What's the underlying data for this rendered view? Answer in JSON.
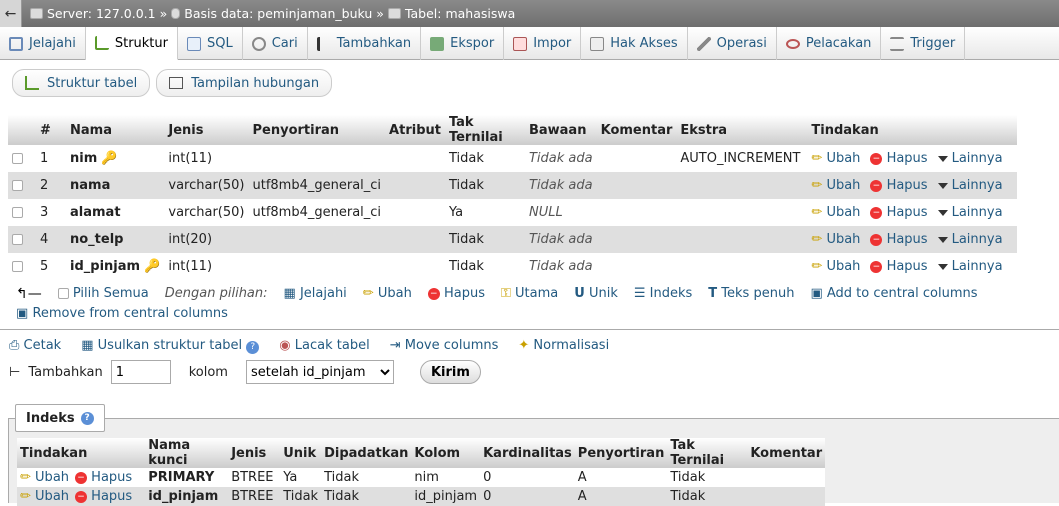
{
  "breadcrumb": {
    "server": "Server: 127.0.0.1",
    "database": "Basis data: peminjaman_buku",
    "table": "Tabel: mahasiswa"
  },
  "tabs": [
    {
      "label": "Jelajahi",
      "icon": "browse-icon"
    },
    {
      "label": "Struktur",
      "icon": "structure-icon",
      "active": true
    },
    {
      "label": "SQL",
      "icon": "sql-icon"
    },
    {
      "label": "Cari",
      "icon": "search-icon"
    },
    {
      "label": "Tambahkan",
      "icon": "insert-icon"
    },
    {
      "label": "Ekspor",
      "icon": "export-icon"
    },
    {
      "label": "Impor",
      "icon": "import-icon"
    },
    {
      "label": "Hak Akses",
      "icon": "privileges-icon"
    },
    {
      "label": "Operasi",
      "icon": "wrench-icon"
    },
    {
      "label": "Pelacakan",
      "icon": "eye-icon"
    },
    {
      "label": "Trigger",
      "icon": "trigger-icon"
    }
  ],
  "subtabs": {
    "struktur": "Struktur tabel",
    "relasi": "Tampilan hubungan"
  },
  "structure": {
    "headers": [
      "#",
      "Nama",
      "Jenis",
      "Penyortiran",
      "Atribut",
      "Tak Ternilai",
      "Bawaan",
      "Komentar",
      "Ekstra",
      "Tindakan"
    ],
    "rows": [
      {
        "num": "1",
        "name": "nim",
        "type": "int(11)",
        "collation": "",
        "attr": "",
        "null": "Tidak",
        "default": "Tidak ada",
        "comment": "",
        "extra": "AUTO_INCREMENT",
        "key": "primary"
      },
      {
        "num": "2",
        "name": "nama",
        "type": "varchar(50)",
        "collation": "utf8mb4_general_ci",
        "attr": "",
        "null": "Tidak",
        "default": "Tidak ada",
        "comment": "",
        "extra": ""
      },
      {
        "num": "3",
        "name": "alamat",
        "type": "varchar(50)",
        "collation": "utf8mb4_general_ci",
        "attr": "",
        "null": "Ya",
        "default": "NULL",
        "comment": "",
        "extra": ""
      },
      {
        "num": "4",
        "name": "no_telp",
        "type": "int(20)",
        "collation": "",
        "attr": "",
        "null": "Tidak",
        "default": "Tidak ada",
        "comment": "",
        "extra": ""
      },
      {
        "num": "5",
        "name": "id_pinjam",
        "type": "int(11)",
        "collation": "",
        "attr": "",
        "null": "Tidak",
        "default": "Tidak ada",
        "comment": "",
        "extra": "",
        "key": "index"
      }
    ],
    "actions": {
      "edit": "Ubah",
      "delete": "Hapus",
      "more": "Lainnya"
    }
  },
  "with_selected": {
    "check_all": "Pilih Semua",
    "label": "Dengan pilihan:",
    "items": [
      "Jelajahi",
      "Ubah",
      "Hapus",
      "Utama",
      "Unik",
      "Indeks",
      "Teks penuh",
      "Add to central columns",
      "Remove from central columns"
    ]
  },
  "tools": [
    "Cetak",
    "Usulkan struktur tabel",
    "Lacak tabel",
    "Move columns",
    "Normalisasi"
  ],
  "add_column": {
    "label": "Tambahkan",
    "count": "1",
    "unit": "kolom",
    "position": "setelah id_pinjam",
    "submit": "Kirim"
  },
  "indexes": {
    "legend": "Indeks",
    "headers": [
      "Tindakan",
      "Nama kunci",
      "Jenis",
      "Unik",
      "Dipadatkan",
      "Kolom",
      "Kardinalitas",
      "Penyortiran",
      "Tak Ternilai",
      "Komentar"
    ],
    "rows": [
      {
        "key": "PRIMARY",
        "type": "BTREE",
        "unique": "Ya",
        "packed": "Tidak",
        "column": "nim",
        "cardinality": "0",
        "collation": "A",
        "null": "Tidak",
        "comment": ""
      },
      {
        "key": "id_pinjam",
        "type": "BTREE",
        "unique": "Tidak",
        "packed": "Tidak",
        "column": "id_pinjam",
        "cardinality": "0",
        "collation": "A",
        "null": "Tidak",
        "comment": ""
      }
    ],
    "actions": {
      "edit": "Ubah",
      "delete": "Hapus"
    }
  }
}
